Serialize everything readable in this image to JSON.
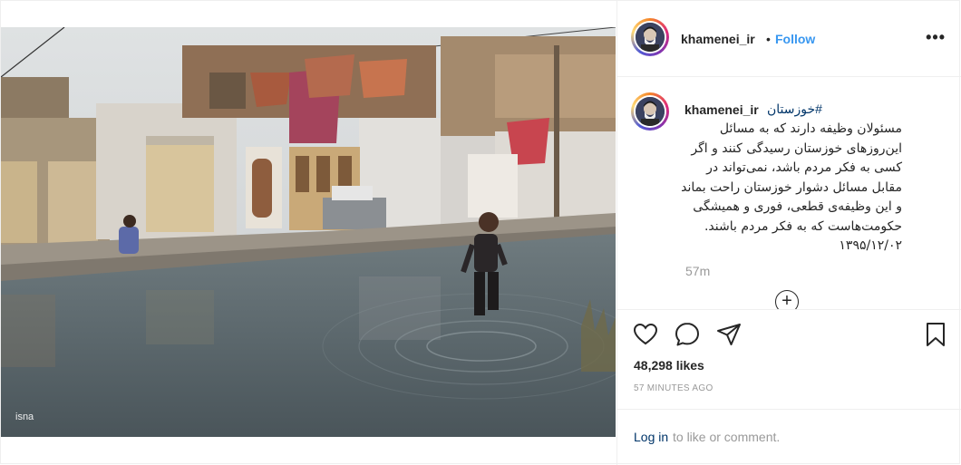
{
  "post": {
    "username": "khamenei_ir",
    "separator": "•",
    "follow_label": "Follow",
    "more_icon": "more-options-icon",
    "more_label": "•••",
    "photo_credit": "isna"
  },
  "caption": {
    "username": "khamenei_ir",
    "hashtag": "#خوزستان",
    "lines": [
      "مسئولان وظیفه دارند که به مسائل",
      "این‌روزهای خوزستان رسیدگی کنند و اگر",
      "کسی به فکر مردم باشد، نمی‌تواند در",
      "مقابل مسائل دشوار خوزستان راحت بماند",
      "و این وظیفه‌ی قطعی، فوری و همیشگی",
      "حکومت‌هاست که به فکر مردم باشند.",
      "۱۳۹۵/۱۲/۰۲"
    ],
    "time_ago": "57m",
    "load_more_label": "+"
  },
  "actions": {
    "icons": [
      "heart-icon",
      "comment-icon",
      "share-icon",
      "bookmark-icon"
    ]
  },
  "likes_text": "48,298 likes",
  "timestamp": "57 MINUTES AGO",
  "comment_bar": {
    "login_label": "Log in",
    "rest_text": "to like or comment."
  },
  "colors": {
    "follow": "#3897f0",
    "link": "#003569",
    "muted": "#999999",
    "text": "#262626",
    "border": "#efefef"
  }
}
